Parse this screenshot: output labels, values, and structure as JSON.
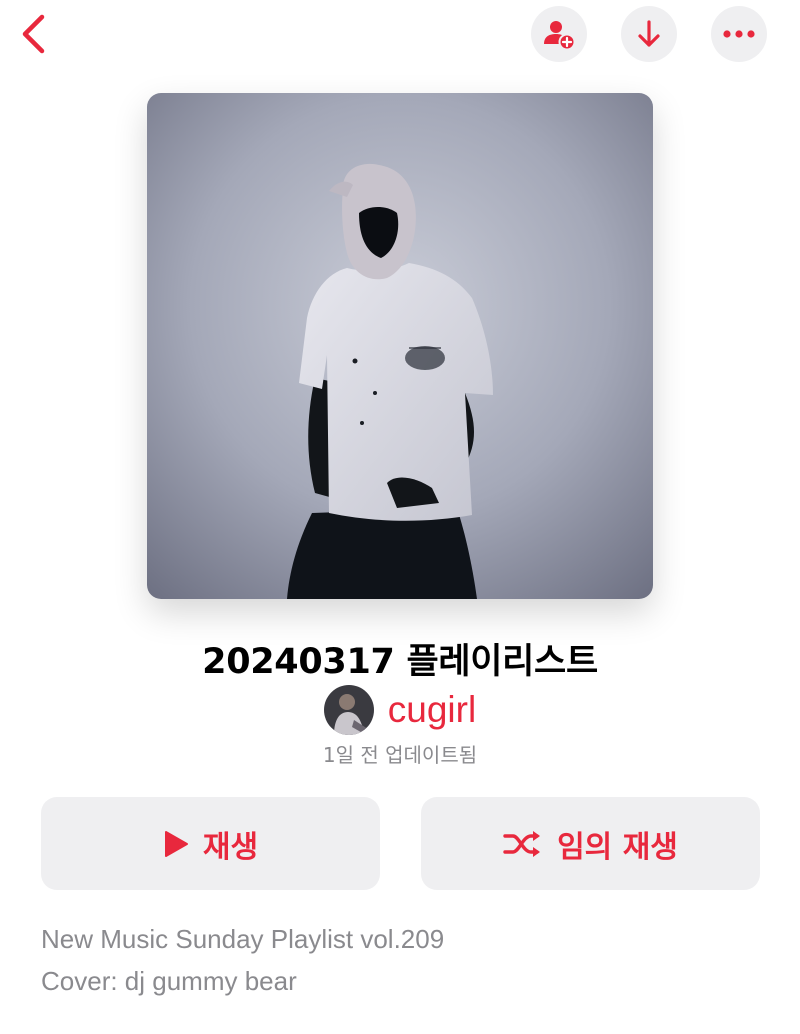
{
  "header": {
    "back_icon": "chevron-left-icon",
    "actions": [
      {
        "icon": "add-person-icon"
      },
      {
        "icon": "download-arrow-icon"
      },
      {
        "icon": "more-ellipsis-icon"
      }
    ]
  },
  "playlist": {
    "title": "20240317 플레이리스트",
    "curator": "cugirl",
    "updated": "1일 전 업데이트됨"
  },
  "buttons": {
    "play_label": "재생",
    "play_icon": "play-icon",
    "shuffle_label": "임의 재생",
    "shuffle_icon": "shuffle-icon"
  },
  "description": {
    "line1": "New Music Sunday Playlist vol.209",
    "line2": "Cover: dj gummy bear"
  },
  "colors": {
    "accent": "#e8283d",
    "button_bg": "#efeff1",
    "secondary_text": "#8a8a8e"
  }
}
